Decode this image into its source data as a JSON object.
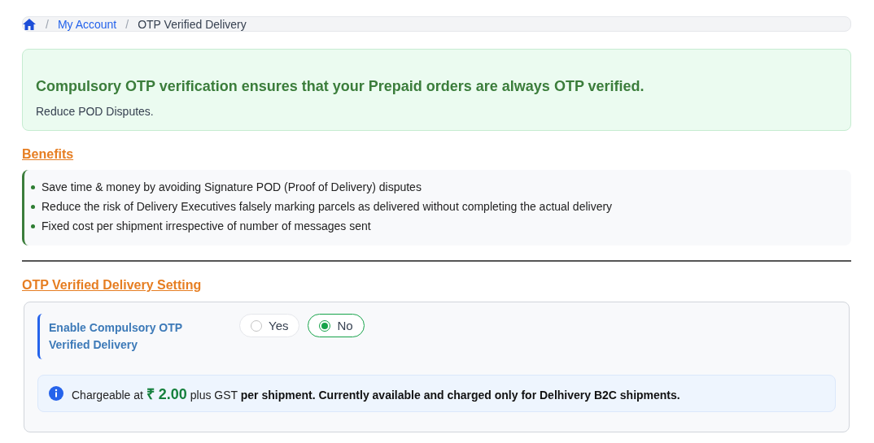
{
  "breadcrumb": [
    {
      "separator": "/",
      "label": "My Account",
      "kind": "link"
    },
    {
      "separator": "/",
      "label": "OTP Verified Delivery",
      "kind": "current"
    }
  ],
  "alert": {
    "title": "Compulsory OTP verification ensures that your Prepaid orders are always OTP verified.",
    "text": "Reduce POD Disputes."
  },
  "benefits": {
    "heading": "Benefits",
    "items": [
      "Save time & money by avoiding Signature POD (Proof of Delivery) disputes",
      "Reduce the risk of Delivery Executives falsely marking parcels as delivered without completing the actual delivery",
      "Fixed cost per shipment irrespective of number of messages sent"
    ]
  },
  "setting": {
    "heading": "OTP Verified Delivery Setting",
    "label": "Enable Compulsory OTP Verified Delivery",
    "options": [
      {
        "label": "Yes",
        "selected": false
      },
      {
        "label": "No",
        "selected": true
      }
    ],
    "note": "Chargeable at **₹ 2.00** plus GST **per shipment. Currently available and charged only for Delhivery B2C shipments.**"
  }
}
